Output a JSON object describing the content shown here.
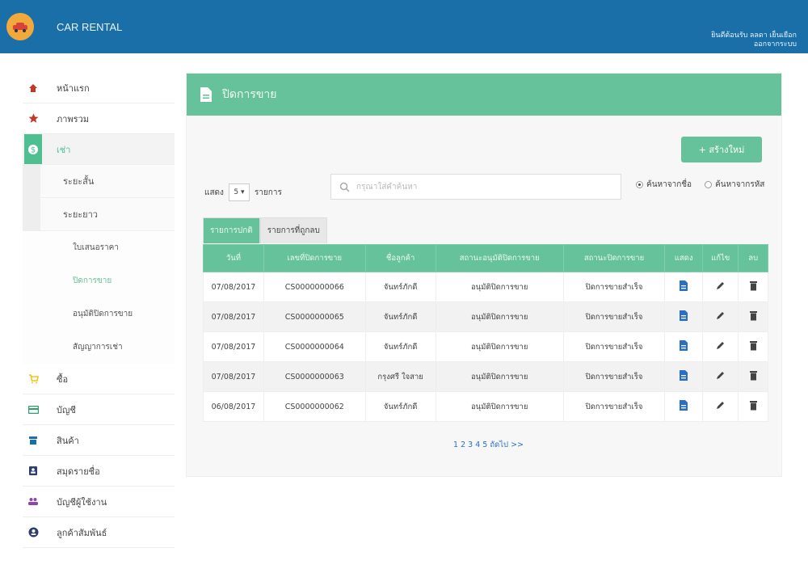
{
  "header": {
    "app_name": "CAR RENTAL",
    "welcome": "ยินดีต้อนรับ ลลดา เย็นเยือก",
    "logout": "ออกจากระบบ"
  },
  "sidebar": {
    "items": [
      {
        "label": "หน้าแรก",
        "icon": "home-icon"
      },
      {
        "label": "ภาพรวม",
        "icon": "star-icon"
      },
      {
        "label": "เช่า",
        "icon": "dollar-icon"
      }
    ],
    "rent_sub": [
      "ระยะสั้น",
      "ระยะยาว"
    ],
    "long_sub": [
      "ใบเสนอราคา",
      "ปิดการขาย",
      "อนุมัติปิดการขาย",
      "สัญญาการเช่า"
    ],
    "items2": [
      {
        "label": "ซื้อ",
        "icon": "cart-icon"
      },
      {
        "label": "บัญชี",
        "icon": "card-icon"
      },
      {
        "label": "สินค้า",
        "icon": "store-icon"
      },
      {
        "label": "สมุดรายชื่อ",
        "icon": "contact-book-icon"
      },
      {
        "label": "บัญชีผู้ใช้งาน",
        "icon": "users-icon"
      },
      {
        "label": "ลูกค้าสัมพันธ์",
        "icon": "user-circle-icon"
      }
    ]
  },
  "page": {
    "title": "ปิดการขาย",
    "new_button": "+ สร้างใหม่",
    "show_label": "แสดง",
    "show_value": "5",
    "show_suffix": "รายการ",
    "search_placeholder": "กรุณาใส่คำค้นหา",
    "radio_name": "ค้นหาจากชื่อ",
    "radio_code": "ค้นหาจากรหัส",
    "tab_all": "รายการปกติ",
    "tab_deleted": "รายการที่ถูกลบ",
    "pager": "1 2 3 4 5 ถัดไป >>"
  },
  "table": {
    "headers": [
      "วันที่",
      "เลขที่ปิดการขาย",
      "ชื่อลูกค้า",
      "สถานะอนุมัติปิดการขาย",
      "สถานะปิดการขาย",
      "แสดง",
      "แก้ไข",
      "ลบ"
    ],
    "rows": [
      [
        "07/08/2017",
        "CS0000000066",
        "จันทร์ภักดี",
        "อนุมัติปิดการขาย",
        "ปิดการขายสำเร็จ"
      ],
      [
        "07/08/2017",
        "CS0000000065",
        "จันทร์ภักดี",
        "อนุมัติปิดการขาย",
        "ปิดการขายสำเร็จ"
      ],
      [
        "07/08/2017",
        "CS0000000064",
        "จันทร์ภักดี",
        "อนุมัติปิดการขาย",
        "ปิดการขายสำเร็จ"
      ],
      [
        "07/08/2017",
        "CS0000000063",
        "กรุงศรี ใจสาย",
        "อนุมัติปิดการขาย",
        "ปิดการขายสำเร็จ"
      ],
      [
        "06/08/2017",
        "CS0000000062",
        "จันทร์ภักดี",
        "อนุมัติปิดการขาย",
        "ปิดการขายสำเร็จ"
      ]
    ]
  },
  "colors": {
    "header": "#1a6fa8",
    "accent": "#66c29a",
    "icon_blue": "#2a6fc7",
    "danger": "#d33"
  }
}
